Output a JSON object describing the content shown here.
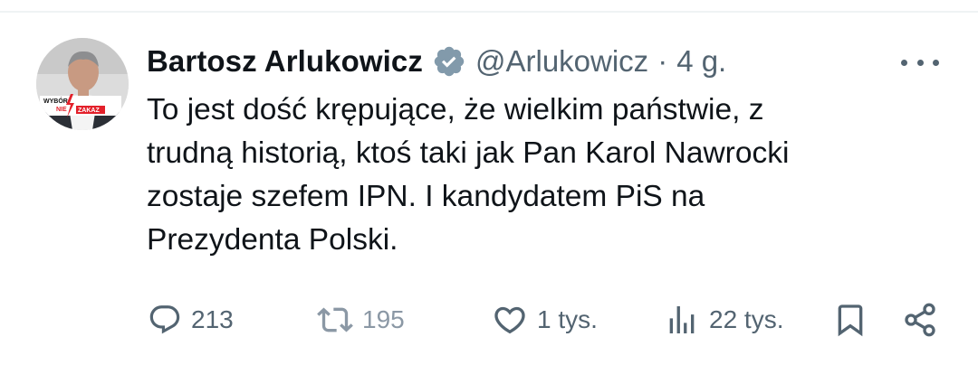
{
  "author": {
    "name": "Bartosz Arlukowicz",
    "handle": "@Arlukowicz",
    "separator": "·",
    "time": "4 g."
  },
  "avatar": {
    "badge_line1": "WYBÓR",
    "badge_line2a": "NIE",
    "badge_line2b": "ZAKAZ"
  },
  "tweet": {
    "lines": [
      "To jest dość krępujące, że wielkim państwie, z",
      "trudną historią, ktoś taki jak Pan Karol Nawrocki",
      "zostaje szefem IPN. I kandydatem PiS na",
      "Prezydenta Polski."
    ]
  },
  "actions": {
    "replies": "213",
    "reposts": "195",
    "likes": "1 tys.",
    "views": "22 tys."
  },
  "icons": {
    "verified": "verified-badge-icon",
    "more": "more-horizontal-icon",
    "reply": "reply-icon",
    "repost": "repost-icon",
    "like": "heart-icon",
    "views": "views-chart-icon",
    "bookmark": "bookmark-icon",
    "share": "share-icon"
  },
  "colors": {
    "text": "#0f1419",
    "secondary": "#536471",
    "verified_badge": "#829aab",
    "divider": "#eff3f4"
  }
}
